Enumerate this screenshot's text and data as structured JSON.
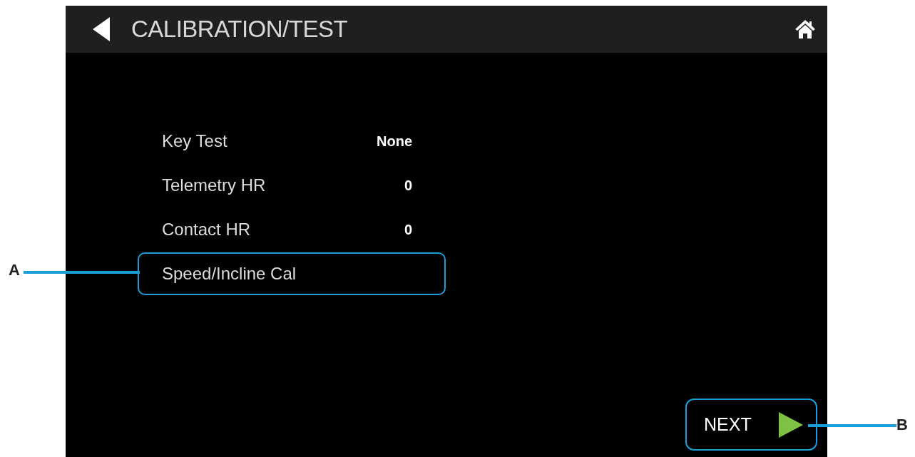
{
  "header": {
    "title": "CALIBRATION/TEST"
  },
  "rows": [
    {
      "label": "Key Test",
      "value": "None",
      "selected": false
    },
    {
      "label": "Telemetry HR",
      "value": "0",
      "selected": false
    },
    {
      "label": "Contact HR",
      "value": "0",
      "selected": false
    },
    {
      "label": "Speed/Incline Cal",
      "selected": true
    }
  ],
  "next_button": {
    "label": "NEXT",
    "selected": true
  },
  "callouts": [
    {
      "label": "A"
    },
    {
      "label": "B"
    }
  ]
}
